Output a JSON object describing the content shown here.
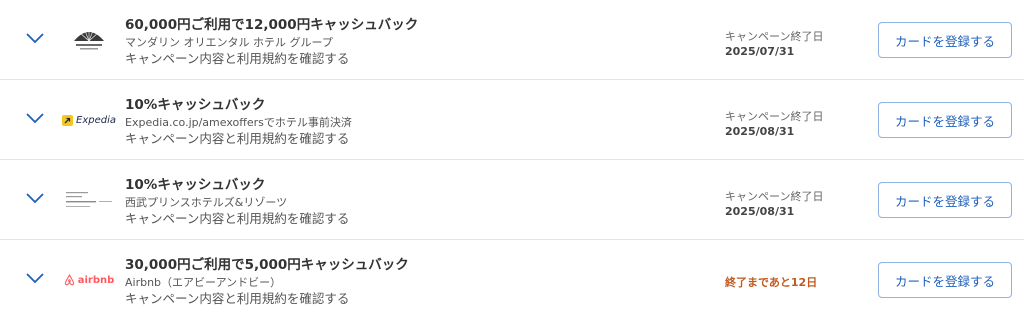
{
  "theme": {
    "accent": "#1f5fbf",
    "countdown_color": "#c05a1f",
    "expedia_yellow": "#f4c81f",
    "airbnb_red": "#ff5a5f"
  },
  "offers": [
    {
      "offer": "60,000円ご利用で12,000円キャッシュバック",
      "merchant": "マンダリン オリエンタル ホテル グループ",
      "terms_link": "キャンペーン内容と利用規約を確認する",
      "end_label": "キャンペーン終了日",
      "end_date": "2025/07/31",
      "button": "カードを登録する",
      "logo_icon": "mandarin-oriental-fan-logo"
    },
    {
      "offer": "10%キャッシュバック",
      "merchant": "Expedia.co.jp/amexoffersでホテル事前決済",
      "terms_link": "キャンペーン内容と利用規約を確認する",
      "end_label": "キャンペーン終了日",
      "end_date": "2025/08/31",
      "button": "カードを登録する",
      "logo_text": "Expedia",
      "logo_icon": "expedia-arrow-logo"
    },
    {
      "offer": "10%キャッシュバック",
      "merchant": "西武プリンスホテルズ&リゾーツ",
      "terms_link": "キャンペーン内容と利用規約を確認する",
      "end_label": "キャンペーン終了日",
      "end_date": "2025/08/31",
      "button": "カードを登録する",
      "logo_icon": "prince-hotels-logo"
    },
    {
      "offer": "30,000円ご利用で5,000円キャッシュバック",
      "merchant": "Airbnb（エアビーアンドビー）",
      "terms_link": "キャンペーン内容と利用規約を確認する",
      "countdown": "終了まであと12日",
      "button": "カードを登録する",
      "logo_text": "airbnb",
      "logo_icon": "airbnb-belo-logo"
    }
  ]
}
